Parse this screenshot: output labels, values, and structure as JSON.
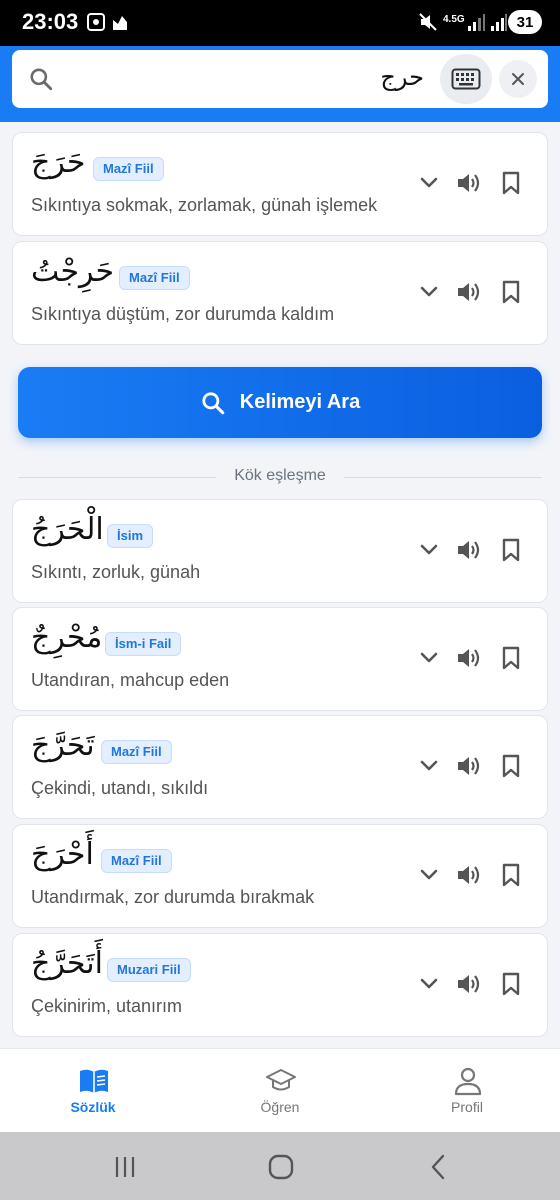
{
  "status": {
    "time": "23:03",
    "network": "4.5G",
    "battery": "31"
  },
  "search": {
    "query": "حرج",
    "keyboard_icon": "keyboard-icon",
    "clear_icon": "close-icon"
  },
  "results": [
    {
      "arabic": "حَرَجَ",
      "type": "Mazî Fiil",
      "meaning": "Sıkıntıya sokmak, zorlamak, günah işlemek"
    },
    {
      "arabic": "حَرِجْتُ",
      "type": "Mazî Fiil",
      "meaning": "Sıkıntıya düştüm, zor durumda kaldım"
    }
  ],
  "search_button": {
    "label": "Kelimeyi Ara"
  },
  "root_section": {
    "label": "Kök eşleşme"
  },
  "root_results": [
    {
      "arabic": "الْحَرَجُ",
      "type": "İsim",
      "meaning": "Sıkıntı, zorluk, günah"
    },
    {
      "arabic": "مُحْرِجٌ",
      "type": "İsm-i Fail",
      "meaning": "Utandıran, mahcup eden"
    },
    {
      "arabic": "تَحَرَّجَ",
      "type": "Mazî Fiil",
      "meaning": "Çekindi, utandı, sıkıldı"
    },
    {
      "arabic": "أَحْرَجَ",
      "type": "Mazî Fiil",
      "meaning": "Utandırmak, zor durumda bırakmak"
    },
    {
      "arabic": "أَتَحَرَّجُ",
      "type": "Muzari Fiil",
      "meaning": "Çekinirim, utanırım"
    }
  ],
  "bottom_nav": {
    "items": [
      {
        "label": "Sözlük",
        "icon": "book-icon",
        "active": true
      },
      {
        "label": "Öğren",
        "icon": "graduation-cap-icon",
        "active": false
      },
      {
        "label": "Profil",
        "icon": "user-icon",
        "active": false
      }
    ]
  },
  "colors": {
    "accent": "#1a7cf5",
    "badge_bg": "#e3efff",
    "badge_text": "#2277d8",
    "icon_gray": "#555555"
  }
}
